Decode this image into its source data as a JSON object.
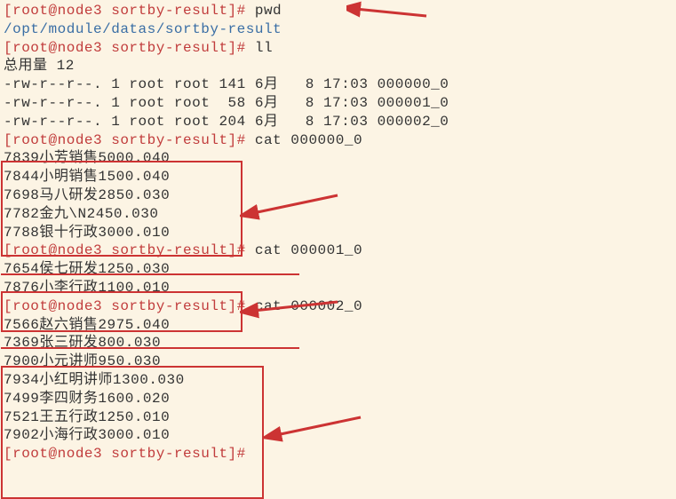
{
  "prompts": {
    "p1": "[root@node3 sortby-result]# ",
    "cmd_pwd": "pwd",
    "pwd_output": "/opt/module/datas/sortby-result",
    "cmd_ll": "ll",
    "ll_total": "总用量 12",
    "ll_row1": "-rw-r--r--. 1 root root 141 6月   8 17:03 000000_0",
    "ll_row2": "-rw-r--r--. 1 root root  58 6月   8 17:03 000001_0",
    "ll_row3": "-rw-r--r--. 1 root root 204 6月   8 17:03 000002_0",
    "cmd_cat0": "cat 000000_0",
    "cat0_lines": [
      "7839小芳销售5000.040",
      "7844小明销售1500.040",
      "7698马八研发2850.030",
      "7782金九\\N2450.030",
      "7788银十行政3000.010"
    ],
    "cmd_cat1": "cat 000001_0",
    "cat1_lines": [
      "7654侯七研发1250.030",
      "7876小李行政1100.010"
    ],
    "cmd_cat2": "cat 000002_0",
    "cat2_lines": [
      "7566赵六销售2975.040",
      "7369张三研发800.030",
      "7900小元讲师950.030",
      "7934小红明讲师1300.030",
      "7499李四财务1600.020",
      "7521王五行政1250.010",
      "7902小海行政3000.010"
    ]
  }
}
